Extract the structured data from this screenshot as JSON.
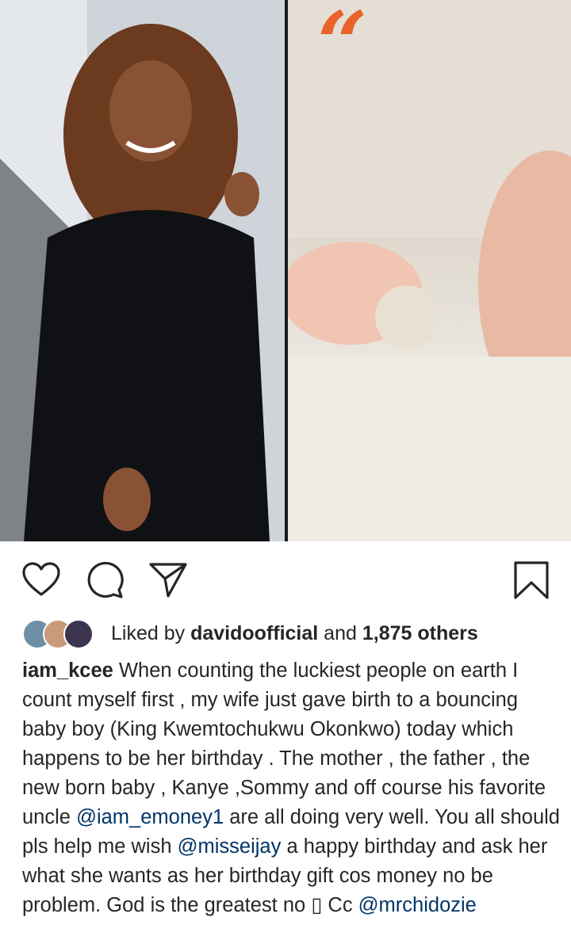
{
  "post": {
    "likes": {
      "prefix": "Liked by",
      "user": "davidoofficial",
      "connector": "and",
      "others": "1,875 others"
    },
    "caption": {
      "username": "iam_kcee",
      "text_1": "When counting the luckiest people on earth I count myself first , my wife just gave birth to a bouncing baby boy (King Kwemtochukwu Okonkwo) today which happens to be her birthday . The mother , the father , the new born baby , Kanye ,Sommy and off course his favorite uncle",
      "mention_1": "@iam_emoney1",
      "text_2": "are all doing very well. You all should  pls help me wish",
      "mention_2": "@misseijay",
      "text_3": "a happy birthday and ask her what she wants as her birthday gift cos money no be problem. God is the greatest no ▯ Cc",
      "mention_3": "@mrchidozie"
    },
    "media": {
      "quote_glyph": "“"
    }
  },
  "icons": {
    "like": "heart-icon",
    "comment": "comment-icon",
    "share": "paper-plane-icon",
    "save": "bookmark-icon"
  },
  "colors": {
    "accent_quote": "#e8622a",
    "mention": "#003569",
    "text": "#262626"
  }
}
